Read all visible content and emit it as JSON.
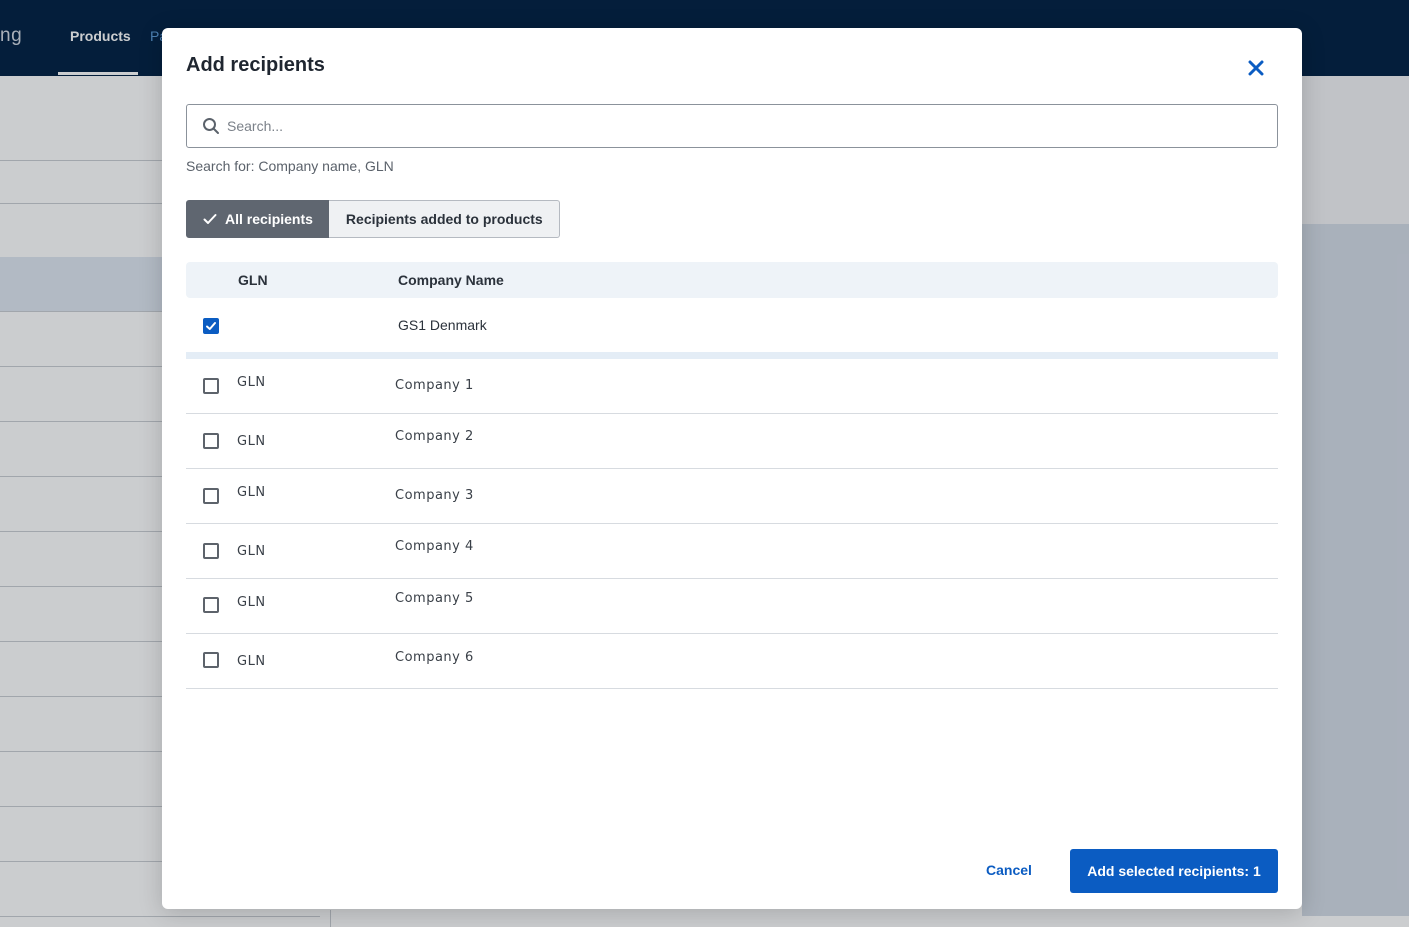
{
  "background": {
    "brand_partial": "ng",
    "nav": {
      "active": "Products",
      "partial": "Pa"
    }
  },
  "modal": {
    "title": "Add recipients",
    "close_icon": "close-icon",
    "search": {
      "placeholder": "Search...",
      "value": "",
      "hint": "Search for: Company name, GLN"
    },
    "filter_tabs": [
      {
        "label": "All recipients",
        "active": true
      },
      {
        "label": "Recipients added to products",
        "active": false
      }
    ],
    "table": {
      "columns": [
        "GLN",
        "Company Name"
      ],
      "selected": [
        {
          "gln": "",
          "company": "GS1 Denmark",
          "checked": true
        }
      ],
      "rows": [
        {
          "gln": "GLN",
          "company": "Company 1",
          "checked": false
        },
        {
          "gln": "GLN",
          "company": "Company 2",
          "checked": false
        },
        {
          "gln": "GLN",
          "company": "Company 3",
          "checked": false
        },
        {
          "gln": "GLN",
          "company": "Company 4",
          "checked": false
        },
        {
          "gln": "GLN",
          "company": "Company 5",
          "checked": false
        },
        {
          "gln": "GLN",
          "company": "Company 6",
          "checked": false
        }
      ]
    },
    "footer": {
      "cancel_label": "Cancel",
      "add_label": "Add selected recipients: 1"
    }
  },
  "colors": {
    "primary": "#0b5cc2",
    "header_bg": "#001f42",
    "active_tab_bg": "#5f6670"
  }
}
